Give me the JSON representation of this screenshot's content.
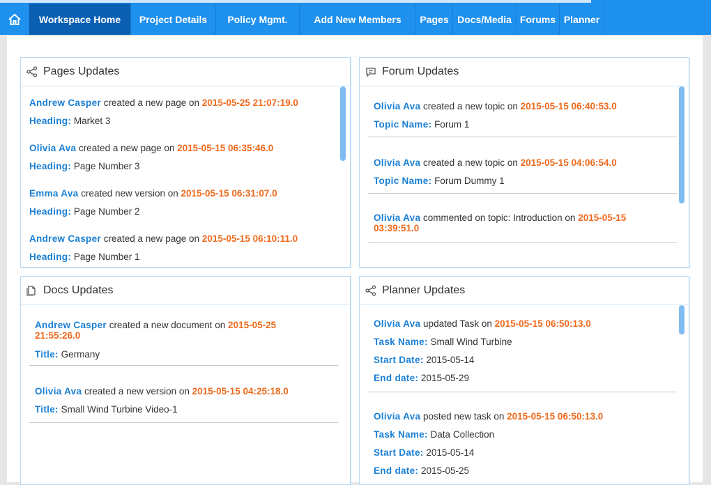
{
  "nav": {
    "home_icon": "home-icon",
    "items": [
      "Workspace Home",
      "Project Details",
      "Policy Mgmt.",
      "Add New Members",
      "Pages",
      "Docs/Media",
      "Forums",
      "Planner"
    ]
  },
  "colors": {
    "nav_bg": "#1e90ee",
    "nav_active": "#0b5fb3",
    "user": "#1a7fd4",
    "date": "#ef6a1c"
  },
  "pages": {
    "title": "Pages Updates",
    "icon": "share-icon",
    "entries": [
      {
        "user": "Andrew Casper",
        "action": " created a new page on ",
        "date": "2015-05-25 21:07:19.0",
        "label": "Heading:",
        "value": " Market 3"
      },
      {
        "user": "Olivia Ava",
        "action": " created a new page on ",
        "date": "2015-05-15 06:35:46.0",
        "label": "Heading:",
        "value": " Page Number 3"
      },
      {
        "user": "Emma Ava",
        "action": " created new version on ",
        "date": "2015-05-15 06:31:07.0",
        "label": "Heading:",
        "value": " Page Number 2"
      },
      {
        "user": "Andrew Casper",
        "action": " created a new page on ",
        "date": "2015-05-15 06:10:11.0",
        "label": "Heading:",
        "value": " Page Number 1"
      }
    ]
  },
  "forum": {
    "title": "Forum Updates",
    "icon": "comment-icon",
    "entries": [
      {
        "user": "Olivia Ava",
        "action": " created a new topic on ",
        "date": "2015-05-15 06:40:53.0",
        "label": "Topic Name:",
        "value": " Forum 1"
      },
      {
        "user": "Olivia Ava",
        "action": " created a new topic on ",
        "date": "2015-05-15 04:06:54.0",
        "label": "Topic Name:",
        "value": " Forum Dummy 1"
      },
      {
        "user": "Olivia Ava",
        "action": " commented on topic: Introduction on ",
        "date_a": "2015-05-15",
        "date_b": "03:39:51.0"
      }
    ]
  },
  "docs": {
    "title": "Docs Updates",
    "icon": "document-icon",
    "entries": [
      {
        "user": "Andrew Casper",
        "action": " created a new document on ",
        "date_a": "2015-05-25",
        "date_b": "21:55:26.0",
        "label": "Title:",
        "value": " Germany"
      },
      {
        "user": "Olivia Ava",
        "action": " created a new version on ",
        "date": "2015-05-15 04:25:18.0",
        "label": "Title:",
        "value": " Small Wind Turbine Video-1"
      }
    ]
  },
  "planner": {
    "title": "Planner Updates",
    "icon": "share-icon",
    "entries": [
      {
        "user": "Olivia Ava",
        "action": " updated Task on ",
        "date": "2015-05-15 06:50:13.0",
        "task_label": "Task Name:",
        "task": " Small Wind Turbine",
        "start_label": "Start Date:",
        "start": " 2015-05-14",
        "end_label": "End date:",
        "end": " 2015-05-29"
      },
      {
        "user": "Olivia Ava",
        "action": " posted new task on ",
        "date": "2015-05-15 06:50:13.0",
        "task_label": "Task Name:",
        "task": " Data Collection",
        "start_label": "Start Date:",
        "start": " 2015-05-14",
        "end_label": "End date:",
        "end": " 2015-05-25"
      }
    ]
  }
}
